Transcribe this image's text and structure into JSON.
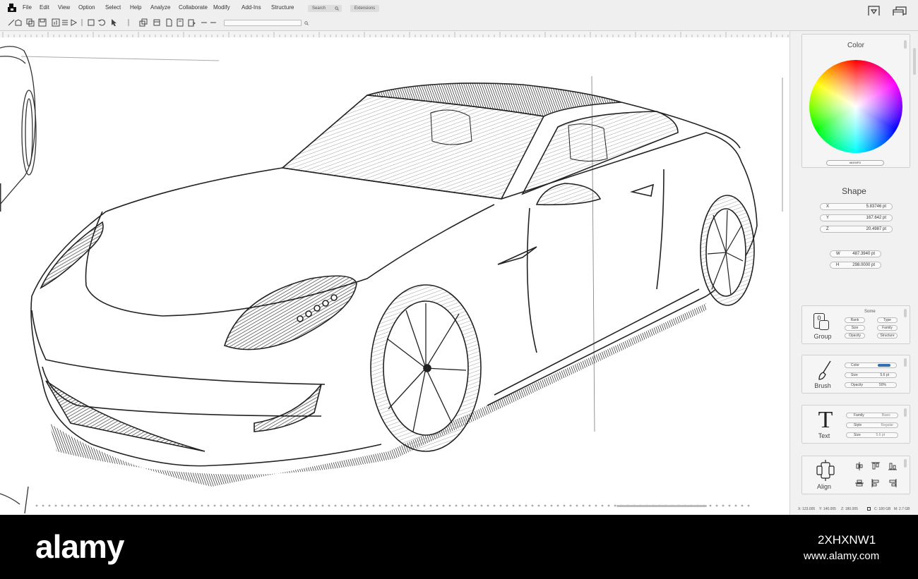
{
  "menu": {
    "items": [
      "File",
      "Edit",
      "View",
      "Option",
      "Select",
      "Help",
      "Analyze",
      "Collaborate",
      "Modify",
      "Add-Ins",
      "Structure"
    ],
    "search_placeholder": "Search",
    "extensions_label": "Extensions"
  },
  "panel": {
    "color": {
      "title": "Color",
      "hex_value": "#6494FD"
    },
    "shape": {
      "title": "Shape",
      "fields": [
        {
          "label": "X",
          "value": "5.83746 pt"
        },
        {
          "label": "Y",
          "value": "167.642 pt"
        },
        {
          "label": "Z",
          "value": "20.4987 pt"
        }
      ],
      "size_fields": [
        {
          "label": "W",
          "value": "487.3940 pt"
        },
        {
          "label": "H",
          "value": "298.0000 pt"
        }
      ]
    },
    "group": {
      "label": "Group",
      "header": "Some",
      "icon_text": "0",
      "buttons": [
        "Rank",
        "Type",
        "Size",
        "Family",
        "Opacity",
        "Structure"
      ]
    },
    "brush": {
      "label": "Brush",
      "rows": [
        {
          "label": "Color",
          "value": ""
        },
        {
          "label": "Size",
          "value": "5.6 pt"
        },
        {
          "label": "Opacity",
          "value": "50%"
        }
      ],
      "swatch_color": "#2f6fb6"
    },
    "text": {
      "label": "Text",
      "icon": "T",
      "rows": [
        {
          "label": "Family",
          "value": "Basic"
        },
        {
          "label": "Style",
          "value": "Regular"
        },
        {
          "label": "Size",
          "value": "5.6 pt"
        }
      ]
    },
    "align": {
      "label": "Align"
    }
  },
  "status": {
    "x": "X: 123.005",
    "y": "Y: 140.005",
    "z": "Z: 180.005",
    "c": "C: 180 GB",
    "m": "M: 2.7 GB"
  },
  "watermark": {
    "logo": "alamy",
    "image_id": "2XHXNW1",
    "url": "www.alamy.com"
  }
}
